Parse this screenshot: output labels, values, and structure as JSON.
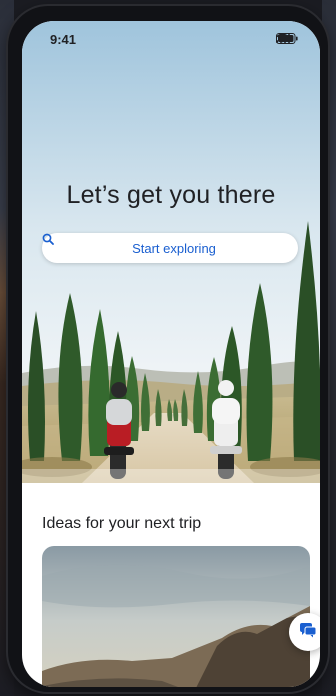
{
  "status_bar": {
    "time": "9:41"
  },
  "hero": {
    "title": "Let’s get you there",
    "search_label": "Start exploring"
  },
  "ideas": {
    "section_title": "Ideas for your next trip"
  },
  "icons": {
    "search": "search-icon",
    "chat": "chat-icon",
    "signal": "cellular-signal-icon",
    "wifi": "wifi-icon",
    "battery": "battery-icon"
  },
  "colors": {
    "accent": "#1a5fd0",
    "title_text": "#202124",
    "sky_top": "#9fc4dc",
    "sky_bottom": "#eef3f6"
  }
}
